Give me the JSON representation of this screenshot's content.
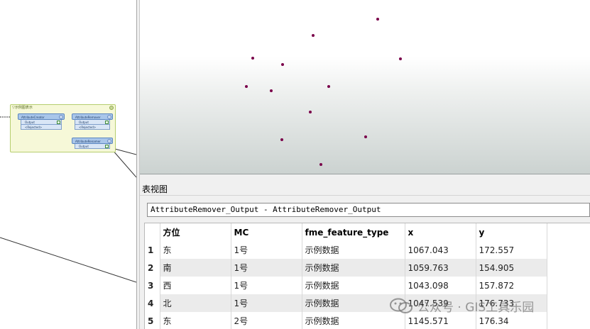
{
  "workspace": {
    "bookmark_title": "▽示例图表示",
    "transformers": [
      {
        "name": "AttributeCreator",
        "ports": [
          "Output",
          "<Rejected>"
        ]
      },
      {
        "name": "AttributeRemover",
        "ports": [
          "Output",
          "<Rejected>"
        ]
      },
      {
        "name": "AttributeRenamer",
        "ports": [
          "Output"
        ]
      }
    ]
  },
  "viewer": {
    "point_color": "#7a004a",
    "points": [
      {
        "x": 1067.043,
        "y": 172.557
      },
      {
        "x": 1059.763,
        "y": 154.905
      },
      {
        "x": 1043.098,
        "y": 157.872
      },
      {
        "x": 1047.539,
        "y": 176.733
      },
      {
        "x": 1145.571,
        "y": 176.34
      }
    ]
  },
  "table_view": {
    "title": "表视图",
    "dataset": "AttributeRemover_Output - AttributeRemover_Output",
    "columns": [
      "",
      "方位",
      "MC",
      "fme_feature_type",
      "x",
      "y"
    ],
    "rows": [
      {
        "n": "1",
        "fw": "东",
        "mc": "1号",
        "type": "示例数据",
        "x": "1067.043",
        "y": "172.557"
      },
      {
        "n": "2",
        "fw": "南",
        "mc": "1号",
        "type": "示例数据",
        "x": "1059.763",
        "y": "154.905"
      },
      {
        "n": "3",
        "fw": "西",
        "mc": "1号",
        "type": "示例数据",
        "x": "1043.098",
        "y": "157.872"
      },
      {
        "n": "4",
        "fw": "北",
        "mc": "1号",
        "type": "示例数据",
        "x": "1047.539",
        "y": "176.733"
      },
      {
        "n": "5",
        "fw": "东",
        "mc": "2号",
        "type": "示例数据",
        "x": "1145.571",
        "y": "176.34"
      }
    ]
  },
  "watermark": {
    "text": "公众号 · GIS工具乐园"
  }
}
